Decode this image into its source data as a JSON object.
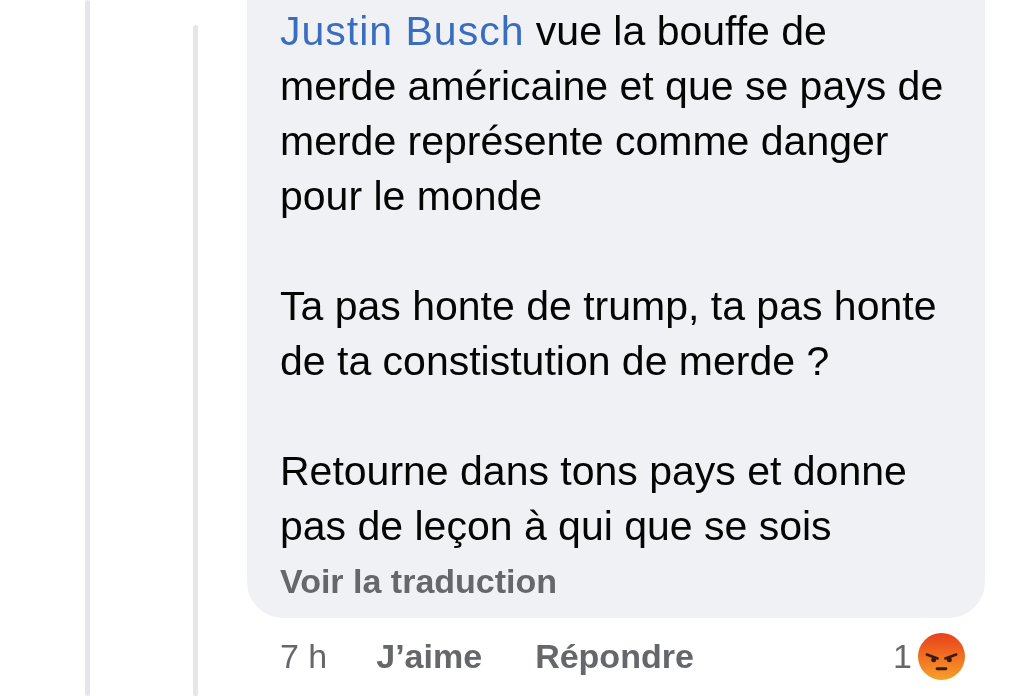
{
  "comment": {
    "mention": "Justin Busch",
    "paragraphs": [
      "vue la bouffe de merde américaine et que se pays de merde représente comme danger pour le monde",
      "Ta pas honte de trump, ta pas honte de ta constistution de merde ?",
      "Retourne dans tons pays et donne pas de leçon à qui que se sois"
    ],
    "translation_link": "Voir la traduction"
  },
  "actions": {
    "time": "7 h",
    "like": "J’aime",
    "reply": "Répondre",
    "reaction_count": "1"
  }
}
